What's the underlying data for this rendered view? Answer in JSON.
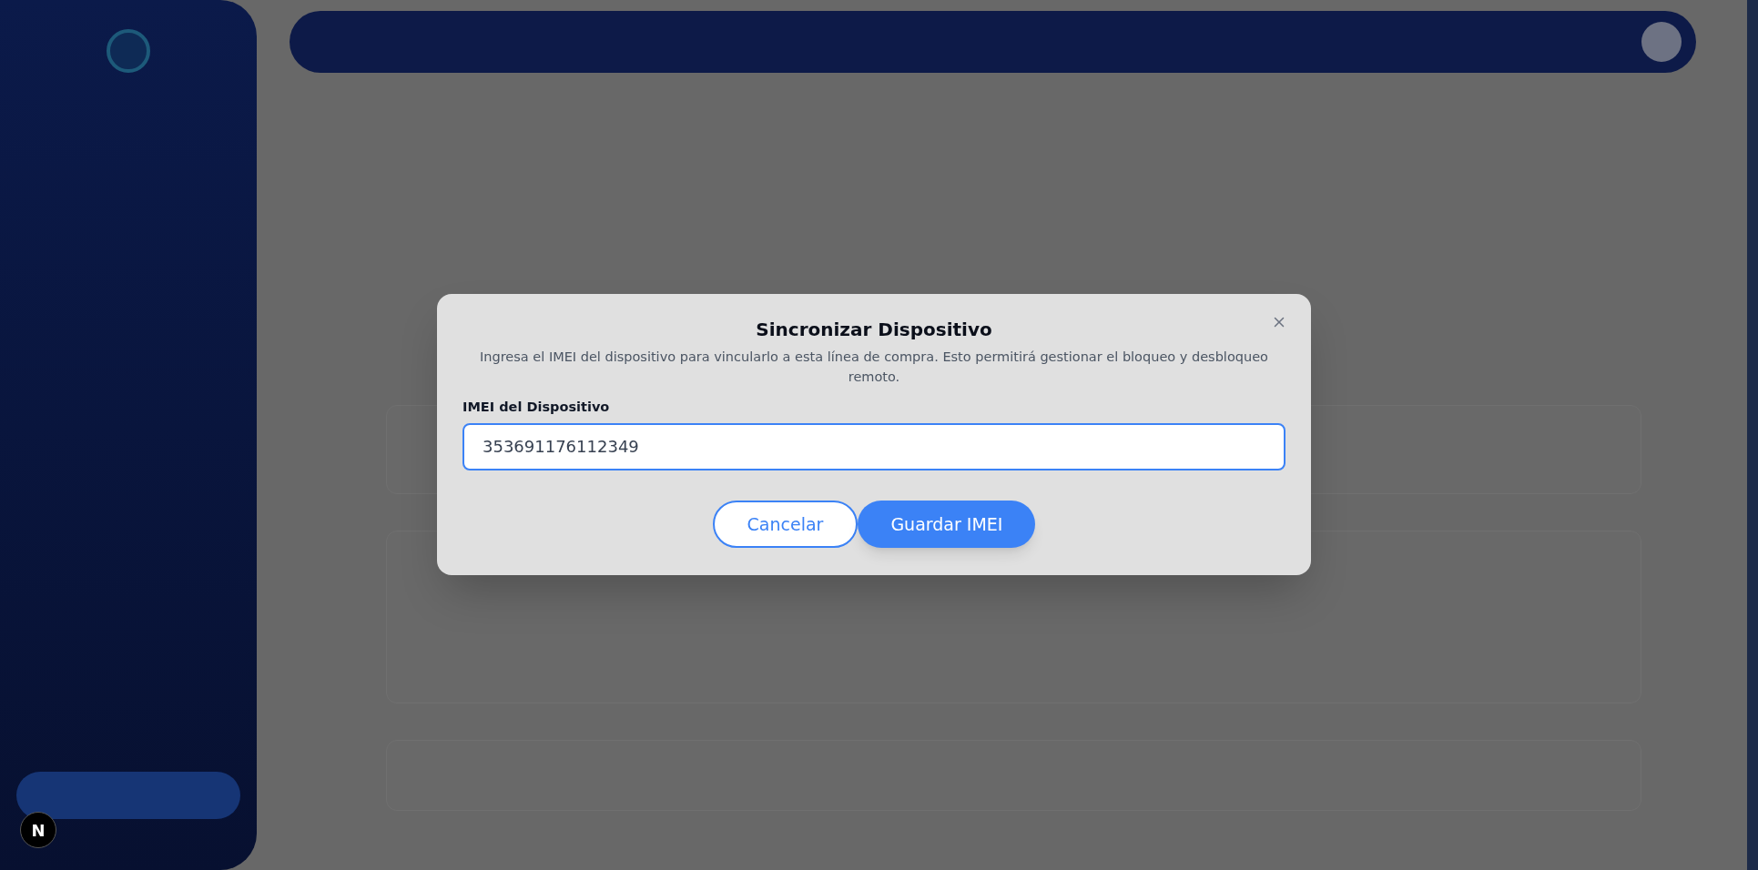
{
  "dialog": {
    "title": "Sincronizar Dispositivo",
    "description": "Ingresa el IMEI del dispositivo para vincularlo a esta línea de compra. Esto permitirá gestionar el bloqueo y desbloqueo remoto.",
    "field": {
      "label": "IMEI del Dispositivo",
      "value": "353691176112349"
    },
    "buttons": [
      {
        "label": "Cancelar",
        "kind": "secondary"
      },
      {
        "label": "Guardar IMEI",
        "kind": "primary"
      }
    ]
  },
  "dev_badge": "N"
}
